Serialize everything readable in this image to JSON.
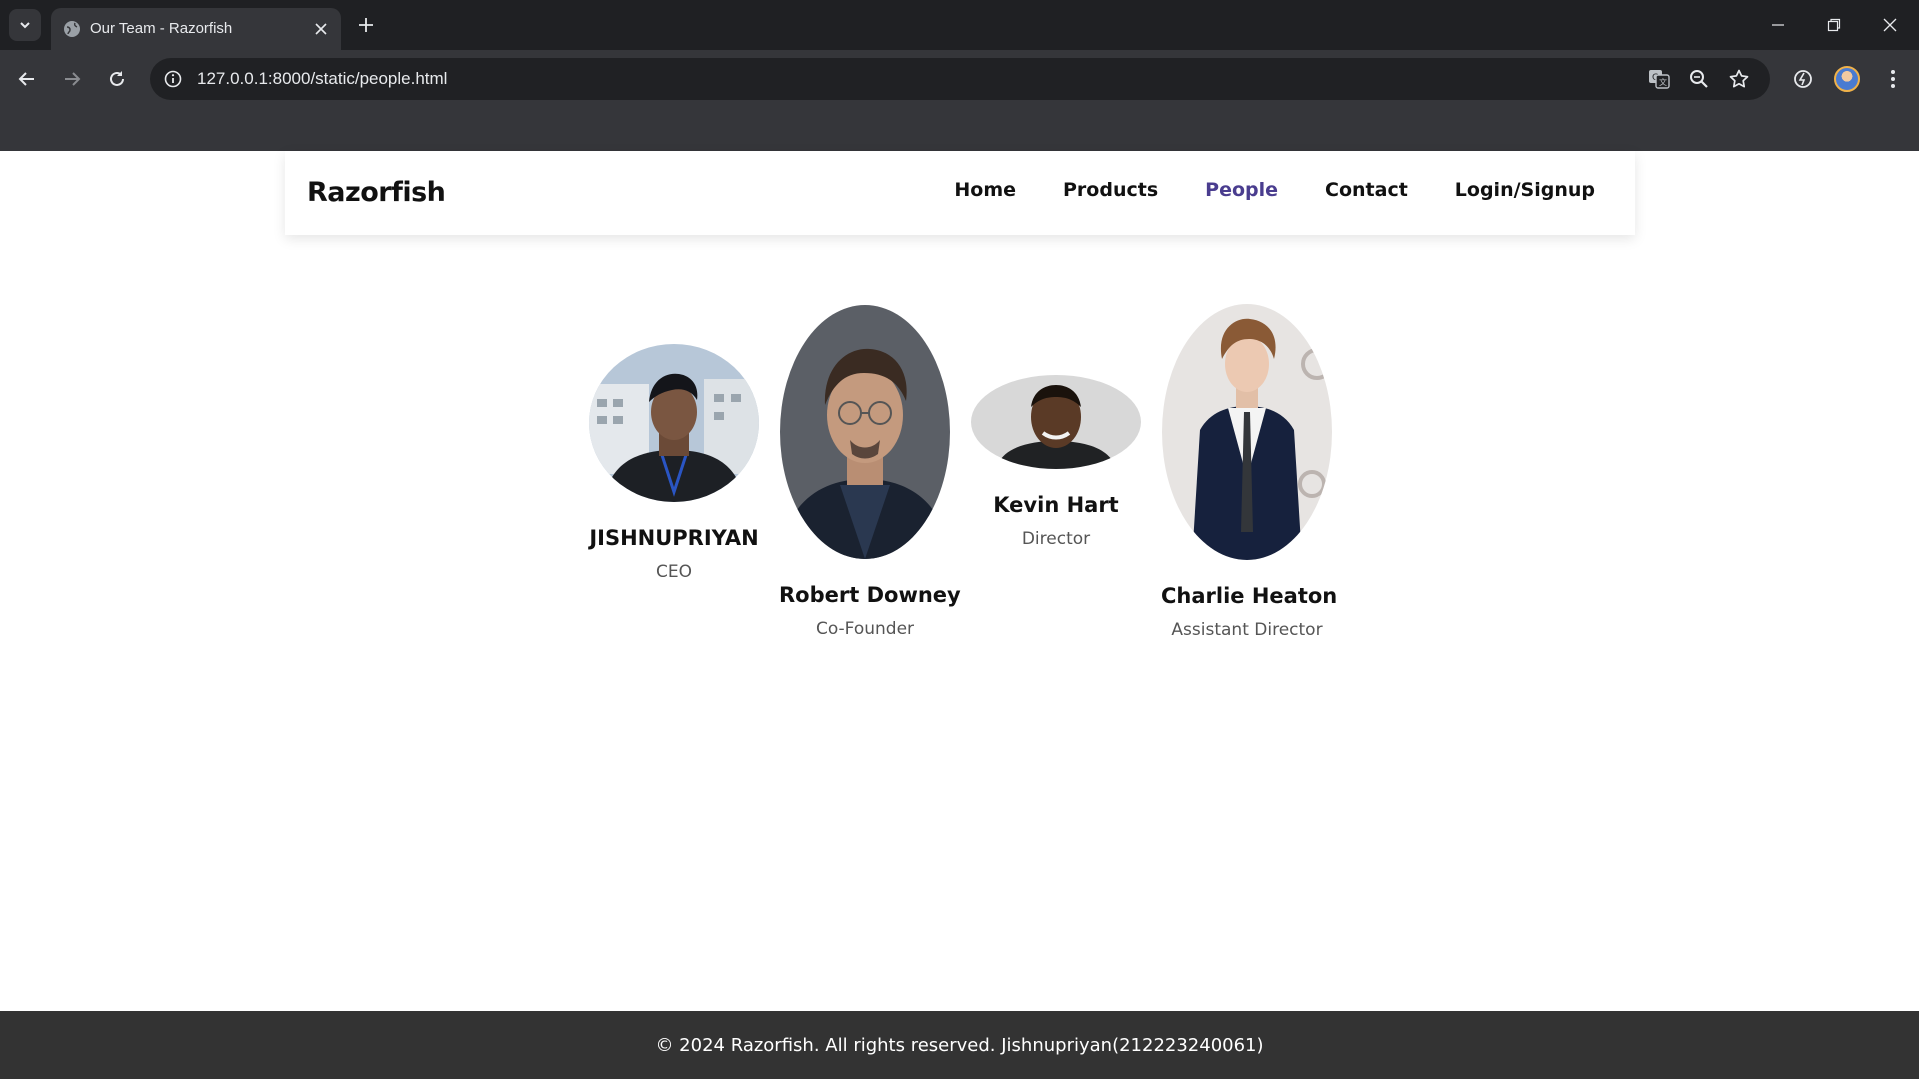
{
  "browser": {
    "tab_title": "Our Team - Razorfish",
    "url": "127.0.0.1:8000/static/people.html"
  },
  "site": {
    "brand": "Razorfish",
    "nav": [
      {
        "label": "Home",
        "active": false
      },
      {
        "label": "Products",
        "active": false
      },
      {
        "label": "People",
        "active": true
      },
      {
        "label": "Contact",
        "active": false
      },
      {
        "label": "Login/Signup",
        "active": false
      }
    ],
    "accent_color": "#4a3d8f"
  },
  "team": [
    {
      "name": "JISHNUPRIYAN",
      "role": "CEO"
    },
    {
      "name": "Robert Downey",
      "role": "Co-Founder"
    },
    {
      "name": "Kevin Hart",
      "role": "Director"
    },
    {
      "name": "Charlie Heaton",
      "role": "Assistant Director"
    }
  ],
  "footer": {
    "text": "© 2024 Razorfish. All rights reserved. Jishnupriyan(212223240061)"
  }
}
